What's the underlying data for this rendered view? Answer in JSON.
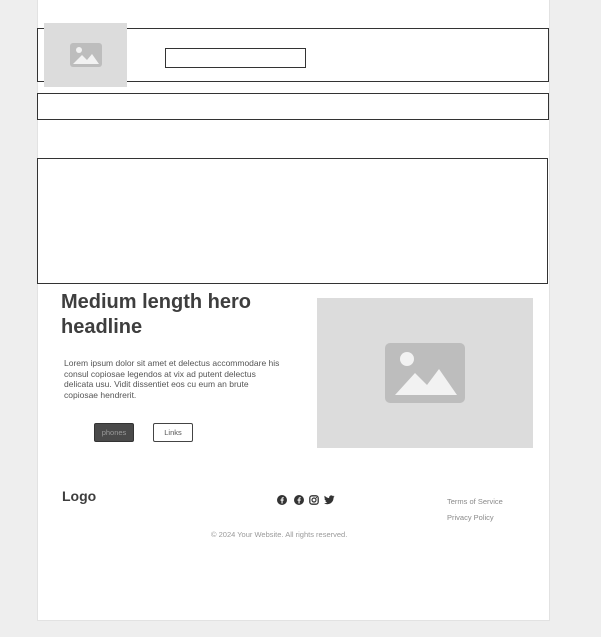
{
  "header": {
    "logo_image": "image-placeholder-icon",
    "nav_box_label": ""
  },
  "hero": {
    "title": "Medium length hero headline",
    "body": "Lorem ipsum dolor sit amet et delectus accommodare his consul copiosae legendos at vix ad putent delectus delicata usu. Vidit dissentiet eos cu eum an brute copiosae hendrerit.",
    "primary_button": "phones",
    "secondary_button": "Links",
    "image": "image-placeholder-icon"
  },
  "footer": {
    "logo": "Logo",
    "social_icons": [
      "facebook-icon",
      "facebook-icon",
      "instagram-icon",
      "twitter-icon"
    ],
    "links": [
      "Terms of Service",
      "Privacy Policy"
    ],
    "copyright": "© 2024 Your Website. All rights reserved."
  },
  "colors": {
    "placeholder": "#dcdcdc",
    "placeholder_icon": "#bdbdbd",
    "dark_button": "#4a4a4a",
    "text": "#3e3e3e"
  }
}
